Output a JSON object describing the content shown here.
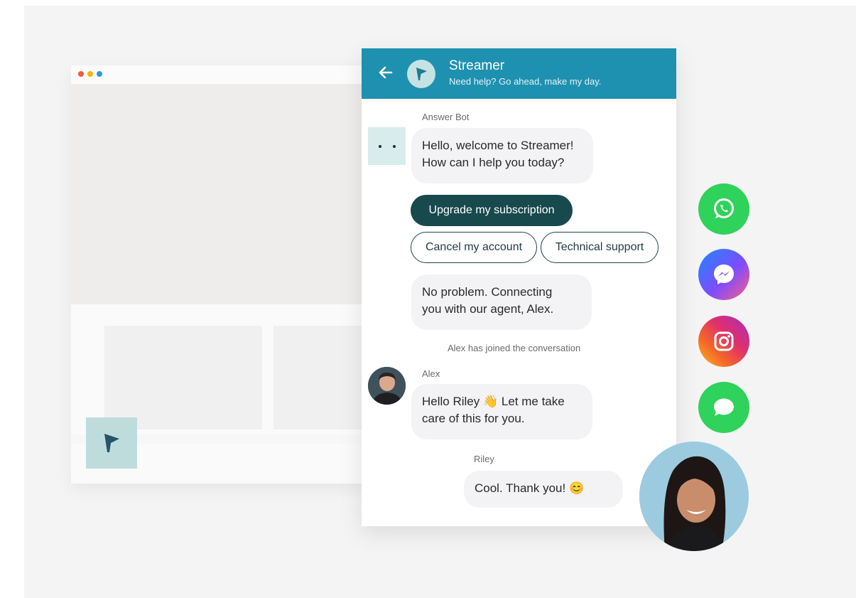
{
  "widget": {
    "title": "Streamer",
    "subtitle": "Need help? Go ahead, make my day."
  },
  "conversation": {
    "bot_name": "Answer Bot",
    "bot_greeting": [
      "Hello, welcome to Streamer!",
      "How can I help you today?"
    ],
    "quick_replies": {
      "upgrade": "Upgrade my subscription",
      "cancel": "Cancel my account",
      "technical": "Technical support"
    },
    "bot_connect": [
      "No problem. Connecting",
      "you with our agent, Alex."
    ],
    "system_event": "Alex has joined the conversation",
    "agent_name": "Alex",
    "agent_message": [
      "Hello Riley ",
      " Let me take",
      "care of this for you."
    ],
    "user_name": "Riley",
    "user_message": "Cool. Thank you! "
  },
  "emoji": {
    "wave": "👋",
    "smile": "😊"
  },
  "channels": [
    "whatsapp-icon",
    "messenger-icon",
    "instagram-icon",
    "message-icon"
  ],
  "colors": {
    "header": "#1f91b0",
    "primary_chip": "#17494d",
    "launcher": "#bfdcdc"
  }
}
